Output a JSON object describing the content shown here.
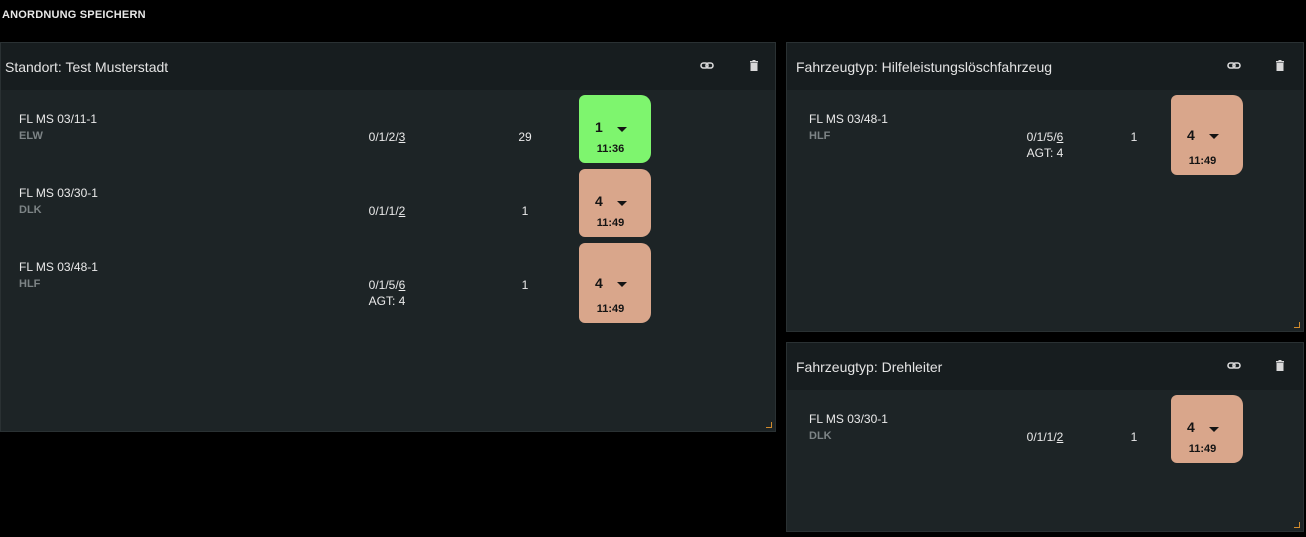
{
  "toolbar": {
    "save_label": "ANORDNUNG SPEICHERN"
  },
  "panels": [
    {
      "title": "Standort: Test Musterstadt",
      "rows": [
        {
          "name": "FL MS 03/11-1",
          "type": "ELW",
          "status_prefix": "0/1/2/",
          "status_u": "3",
          "agt": "",
          "count": "29",
          "status": "1",
          "time": "11:36",
          "color": "#7ef56e"
        },
        {
          "name": "FL MS 03/30-1",
          "type": "DLK",
          "status_prefix": "0/1/1/",
          "status_u": "2",
          "agt": "",
          "count": "1",
          "status": "4",
          "time": "11:49",
          "color": "#d9a68b"
        },
        {
          "name": "FL MS 03/48-1",
          "type": "HLF",
          "status_prefix": "0/1/5/",
          "status_u": "6",
          "agt": "AGT: 4",
          "count": "1",
          "status": "4",
          "time": "11:49",
          "color": "#d9a68b"
        }
      ]
    },
    {
      "title": "Fahrzeugtyp: Hilfeleistungslöschfahrzeug",
      "rows": [
        {
          "name": "FL MS 03/48-1",
          "type": "HLF",
          "status_prefix": "0/1/5/",
          "status_u": "6",
          "agt": "AGT: 4",
          "count": "1",
          "status": "4",
          "time": "11:49",
          "color": "#d9a68b"
        }
      ]
    },
    {
      "title": "Fahrzeugtyp: Drehleiter",
      "rows": [
        {
          "name": "FL MS 03/30-1",
          "type": "DLK",
          "status_prefix": "0/1/1/",
          "status_u": "2",
          "agt": "",
          "count": "1",
          "status": "4",
          "time": "11:49",
          "color": "#d9a68b"
        }
      ]
    }
  ],
  "icons": {
    "link": "link-icon",
    "delete": "trash-icon"
  }
}
